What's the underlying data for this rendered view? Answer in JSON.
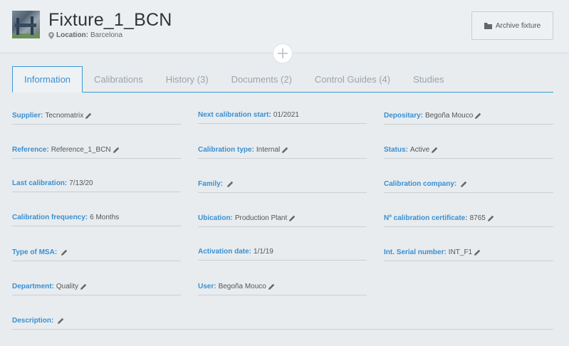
{
  "header": {
    "title": "Fixture_1_BCN",
    "location_label": "Location:",
    "location_value": "Barcelona",
    "archive_label": "Archive fixture"
  },
  "tabs": [
    {
      "label": "Information",
      "active": true
    },
    {
      "label": "Calibrations"
    },
    {
      "label": "History (3)"
    },
    {
      "label": "Documents (2)"
    },
    {
      "label": "Control Guides (4)"
    },
    {
      "label": "Studies"
    }
  ],
  "fields": {
    "supplier": {
      "label": "Supplier:",
      "value": "Tecnomatrix"
    },
    "next_calibration_start": {
      "label": "Next calibration start:",
      "value": "01/2021"
    },
    "depositary": {
      "label": "Depositary:",
      "value": "Begoña Mouco"
    },
    "reference": {
      "label": "Reference:",
      "value": "Reference_1_BCN"
    },
    "calibration_type": {
      "label": "Calibration type:",
      "value": "Internal"
    },
    "status": {
      "label": "Status:",
      "value": "Active"
    },
    "last_calibration": {
      "label": "Last calibration:",
      "value": "7/13/20"
    },
    "family": {
      "label": "Family:",
      "value": ""
    },
    "calibration_company": {
      "label": "Calibration company:",
      "value": ""
    },
    "calibration_frequency": {
      "label": "Calibration frequency:",
      "value": "6 Months"
    },
    "ubication": {
      "label": "Ubication:",
      "value": "Production Plant"
    },
    "calibration_certificate": {
      "label": "Nº calibration certificate:",
      "value": "8765"
    },
    "type_of_msa": {
      "label": "Type of MSA:",
      "value": ""
    },
    "activation_date": {
      "label": "Activation date:",
      "value": "1/1/19"
    },
    "int_serial_number": {
      "label": "Int. Serial number:",
      "value": "INT_F1"
    },
    "department": {
      "label": "Department:",
      "value": "Quality"
    },
    "user": {
      "label": "User:",
      "value": "Begoña Mouco"
    },
    "description": {
      "label": "Description:",
      "value": ""
    }
  },
  "colors": {
    "accent": "#3a8fd0",
    "background": "#e8ecef"
  },
  "icons": {
    "edit": "pencil-icon",
    "location": "map-pin-icon",
    "archive": "folder-icon",
    "add": "plus-icon"
  }
}
